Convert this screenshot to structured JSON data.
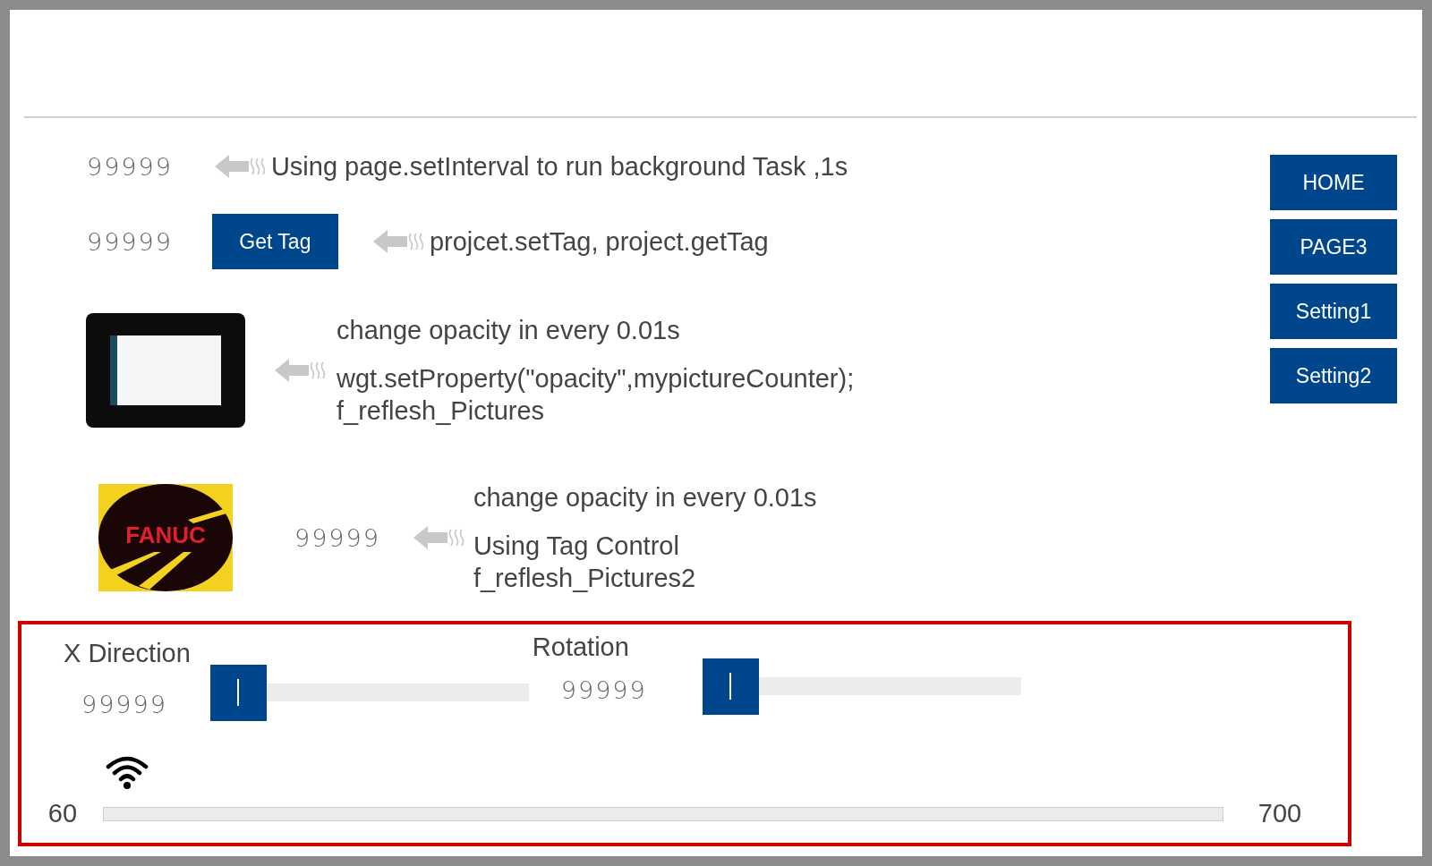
{
  "rows": [
    {
      "kind": "text",
      "value": "99999",
      "lines": [
        "Using page.setInterval to run background Task ,1s"
      ]
    },
    {
      "kind": "button",
      "value": "99999",
      "button": "Get Tag",
      "lines": [
        "projcet.setTag, project.getTag"
      ]
    },
    {
      "kind": "photo",
      "lines": [
        "change opacity in every 0.01s",
        "wgt.setProperty(\"opacity\",mypictureCounter);",
        "f_reflesh_Pictures"
      ]
    },
    {
      "kind": "logo",
      "logo_text": "FANUC",
      "value": "99999",
      "lines": [
        "change opacity in every 0.01s",
        "Using Tag Control",
        "f_reflesh_Pictures2"
      ]
    }
  ],
  "nav_buttons": [
    "HOME",
    "PAGE3",
    "Setting1",
    "Setting2"
  ],
  "controls": {
    "sliders": [
      {
        "label": "X Direction",
        "value": "99999",
        "level": 0
      },
      {
        "label": "Rotation",
        "value": "99999",
        "level": 0
      }
    ],
    "range": {
      "min": "60",
      "max": "700",
      "level": 0
    }
  }
}
